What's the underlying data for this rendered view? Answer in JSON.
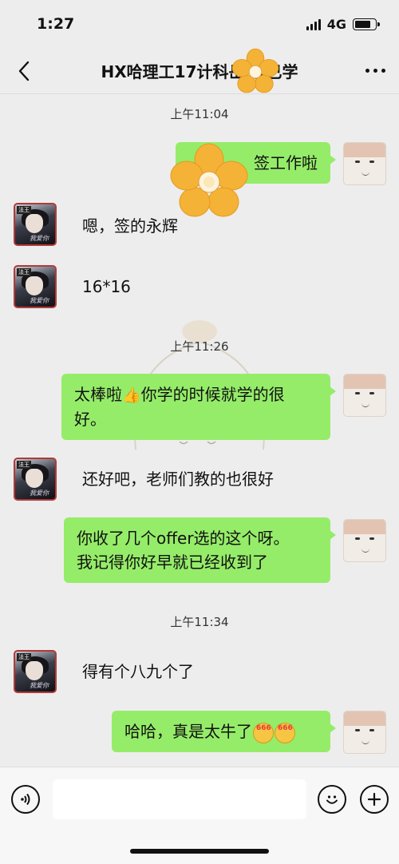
{
  "status_bar": {
    "time": "1:27",
    "network": "4G",
    "battery_level": 0.8
  },
  "nav": {
    "title": "HX哈理工17计科岳 嫌已学"
  },
  "messages": {
    "ts1": "上午11:04",
    "m1": "签工作啦",
    "m2": "嗯，签的永辉",
    "m3": "16*16",
    "ts2": "上午11:26",
    "m4_thumb": "👍",
    "m4_line1_a": "太棒啦",
    "m4_line1_b": "你学的时候就学的很",
    "m4_line2": "好。",
    "m5": "还好吧，老师们教的也很好",
    "m6_line1": "你收了几个offer选的这个呀。",
    "m6_line2": "我记得你好早就已经收到了",
    "ts3": "上午11:34",
    "m7": "得有个八九个了",
    "m8": "哈哈，真是太牛了"
  },
  "avatar_left": {
    "tag": "法王",
    "sign": "我爱你"
  },
  "colors": {
    "bubble": "#95ec69",
    "background": "#ededed"
  },
  "icons": {
    "back": "chevron-left-icon",
    "more": "more-dots-icon",
    "voice": "voice-icon",
    "emoji": "emoji-icon",
    "add": "plus-icon"
  }
}
